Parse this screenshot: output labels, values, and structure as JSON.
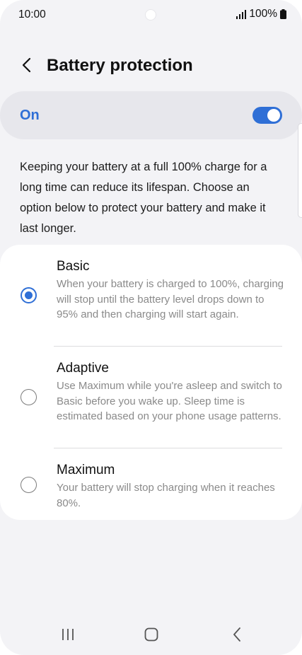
{
  "status_bar": {
    "time": "10:00",
    "battery_percent": "100%",
    "icons": [
      "signal-icon",
      "battery-icon"
    ]
  },
  "header": {
    "title": "Battery protection",
    "back_icon": "back-arrow-icon"
  },
  "master_toggle": {
    "label": "On",
    "state": true
  },
  "description": "Keeping your battery at a full 100% charge for a long time can reduce its lifespan. Choose an option below to protect your battery and make it last longer.",
  "options": [
    {
      "title": "Basic",
      "description": "When your battery is charged to 100%, charging will stop until the battery level drops down to 95% and then charging will start again.",
      "selected": true
    },
    {
      "title": "Adaptive",
      "description": "Use Maximum while you're asleep and switch to Basic before you wake up. Sleep time is estimated based on your phone usage patterns.",
      "selected": false
    },
    {
      "title": "Maximum",
      "description": "Your battery will stop charging when it reaches 80%.",
      "selected": false
    }
  ],
  "nav_bar": {
    "icons": [
      "recents-icon",
      "home-icon",
      "back-icon"
    ]
  },
  "colors": {
    "accent": "#2f6fd6",
    "background": "#f3f3f6",
    "card": "#ffffff",
    "secondary_text": "#8a8a8a"
  }
}
